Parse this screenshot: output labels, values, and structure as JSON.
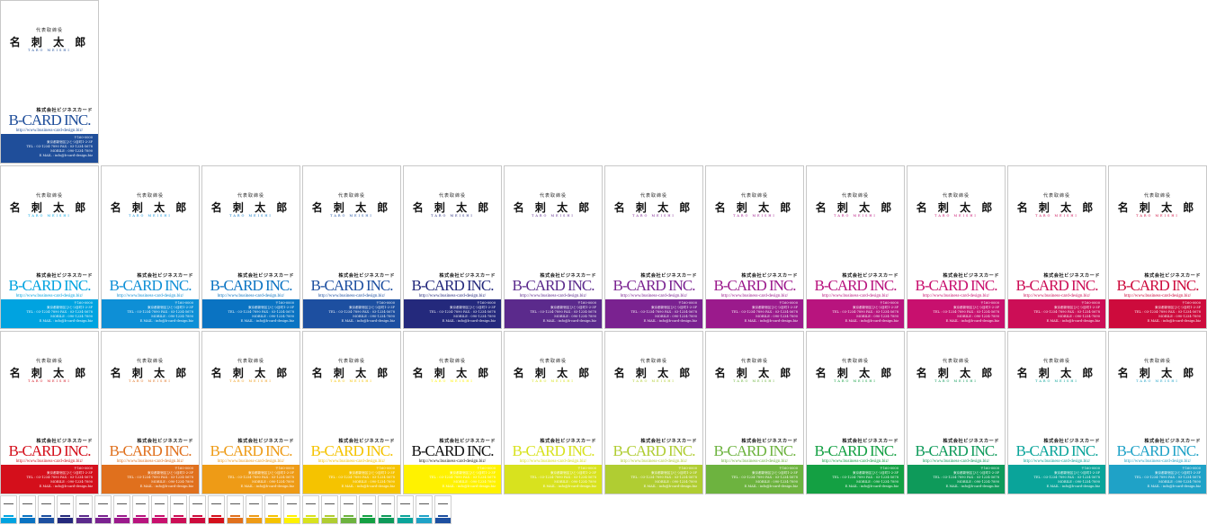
{
  "card_text": {
    "title": "代表取締役",
    "name": "名 刺 太 郎",
    "name_roman": "TARO MEISHI",
    "company": "株式会社ビジネスカード",
    "logo": "B-CARD INC.",
    "url": "http://www.business-card-design.biz/",
    "postal": "〒160-0000",
    "address": "東京都新宿区ひとつ目町1-2-3F",
    "tel_fax": "TEL : 03-1234-7890  FAX : 03-1234-5678",
    "mobile": "MOBILE : 090-1234-7890",
    "email": "E.MAIL : info@b-card-design.biz"
  },
  "featured_color": "#1f4e9a",
  "featured_logo_color": "#1f4e9a",
  "row1_colors": [
    "#00a3e0",
    "#0e8fd6",
    "#0a73c2",
    "#1d4fa0",
    "#24297c",
    "#5b2a8c",
    "#7a2290",
    "#9b1a8c",
    "#b8147e",
    "#c8106e",
    "#cc0e56",
    "#cd0b3c"
  ],
  "row2_colors": [
    "#d40f1b",
    "#e0701d",
    "#ee9b16",
    "#f5c300",
    "#fff200",
    "#d8e21e",
    "#b0cd32",
    "#6db33f",
    "#14a043",
    "#0e9a5a",
    "#0aa49a",
    "#1fa2c7"
  ],
  "row2_logo_overrides": {
    "4": "#111111"
  },
  "thumb_colors": [
    "#00a3e0",
    "#0a73c2",
    "#1d4fa0",
    "#24297c",
    "#5b2a8c",
    "#7a2290",
    "#9b1a8c",
    "#b8147e",
    "#c8106e",
    "#cc0e56",
    "#cd0b3c",
    "#d40f1b",
    "#e0701d",
    "#ee9b16",
    "#f5c300",
    "#fff200",
    "#d8e21e",
    "#b0cd32",
    "#6db33f",
    "#14a043",
    "#0e9a5a",
    "#0aa49a",
    "#1fa2c7",
    "#1d4fa0"
  ]
}
